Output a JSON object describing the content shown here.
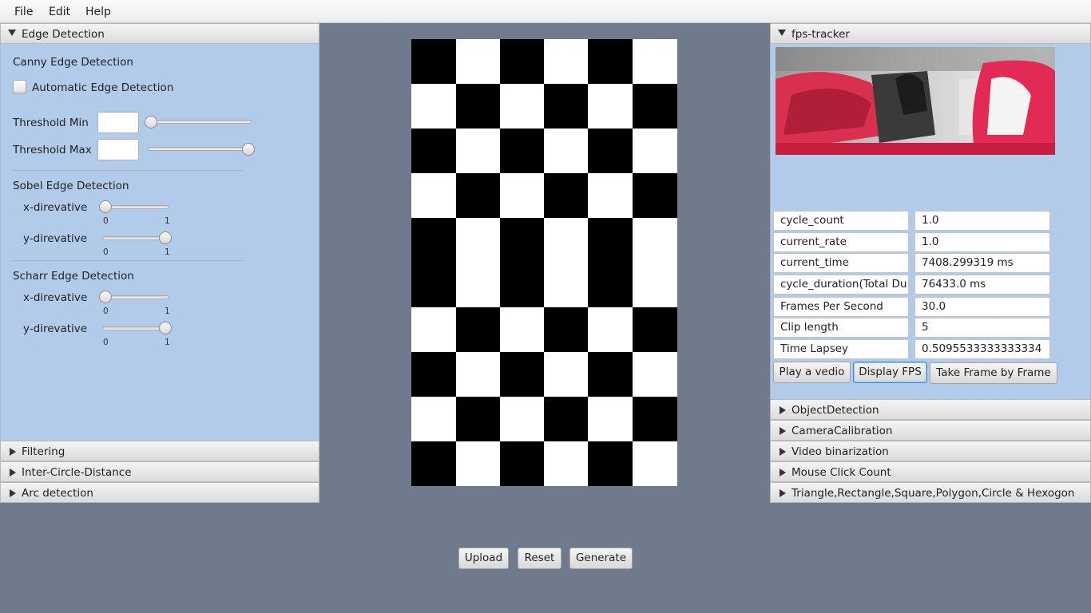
{
  "menu": {
    "file": "File",
    "edit": "Edit",
    "help": "Help"
  },
  "left": {
    "edge_title": "Edge Detection",
    "canny_title": "Canny Edge Detection",
    "auto_label": "Automatic Edge Detection",
    "auto_checked": false,
    "threshold_min_label": "Threshold Min",
    "threshold_min_value": "",
    "threshold_min_slider": 0.0,
    "threshold_max_label": "Threshold Max",
    "threshold_max_value": "",
    "threshold_max_slider": 1.0,
    "sobel_title": "Sobel Edge Detection",
    "sobel_x_label": "x-direvative",
    "sobel_x_value": 0,
    "sobel_y_label": "y-direvative",
    "sobel_y_value": 1,
    "scharr_title": "Scharr Edge Detection",
    "scharr_x_label": "x-direvative",
    "scharr_x_value": 0,
    "scharr_y_label": "y-direvative",
    "scharr_y_value": 1,
    "tick_min": "0",
    "tick_max": "1",
    "collapsed": [
      "Filtering",
      "Inter-Circle-Distance",
      "Arc detection"
    ]
  },
  "center": {
    "upload_label": "Upload",
    "reset_label": "Reset",
    "generate_label": "Generate"
  },
  "right": {
    "fps_title": "fps-tracker",
    "stats": [
      {
        "key": "cycle_count",
        "value": "1.0"
      },
      {
        "key": "current_rate",
        "value": "1.0"
      },
      {
        "key": "current_time",
        "value": "7408.299319 ms"
      },
      {
        "key": "cycle_duration(Total Du",
        "value": "76433.0 ms"
      },
      {
        "key": "Frames Per Second",
        "value": "30.0"
      },
      {
        "key": "Clip length",
        "value": "5"
      },
      {
        "key": "Time Lapsey",
        "value": "0.5095533333333334"
      }
    ],
    "play_label": "Play a vedio",
    "display_fps_label": "Display FPS",
    "take_frame_label": "Take Frame by Frame",
    "collapsed": [
      "ObjectDetection",
      "CameraCalibration",
      "Video binarization",
      "Mouse Click Count",
      "Triangle,Rectangle,Square,Polygon,Circle & Hexogon"
    ]
  },
  "colors": {
    "panel_bg": "#b3cbea",
    "app_bg": "#6f7b8d",
    "focus": "#3c8fd8"
  }
}
